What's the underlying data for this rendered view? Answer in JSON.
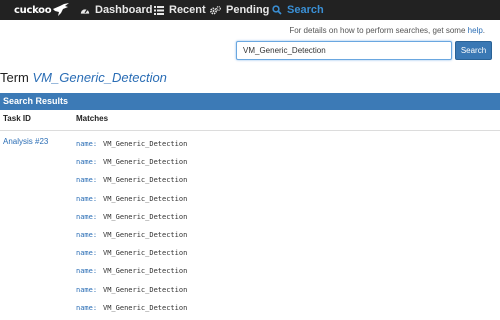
{
  "navbar": {
    "brand": "cuckoo",
    "items": [
      {
        "label": "Dashboard",
        "icon": "dashboard-icon",
        "active": false
      },
      {
        "label": "Recent",
        "icon": "list-icon",
        "active": false
      },
      {
        "label": "Pending",
        "icon": "gears-icon",
        "active": false
      },
      {
        "label": "Search",
        "icon": "search-icon",
        "active": true
      }
    ]
  },
  "help": {
    "prefix": "For details on how to perform searches, get some ",
    "link": "help",
    "suffix": "."
  },
  "search": {
    "value": "VM_Generic_Detection",
    "button": "Search"
  },
  "term": {
    "label": "Term",
    "value": "VM_Generic_Detection"
  },
  "results": {
    "title": "Search Results",
    "columns": [
      "Task ID",
      "Matches"
    ],
    "task_link": "Analysis #23",
    "match_key": "name:",
    "matches": [
      "VM_Generic_Detection",
      "VM_Generic_Detection",
      "VM_Generic_Detection",
      "VM_Generic_Detection",
      "VM_Generic_Detection",
      "VM_Generic_Detection",
      "VM_Generic_Detection",
      "VM_Generic_Detection",
      "VM_Generic_Detection",
      "VM_Generic_Detection"
    ]
  },
  "colors": {
    "navbar_bg": "#222222",
    "active_nav": "#3a8fd4",
    "panel_header": "#3c7ab6",
    "link": "#2a6db5",
    "button": "#3a78b4"
  }
}
